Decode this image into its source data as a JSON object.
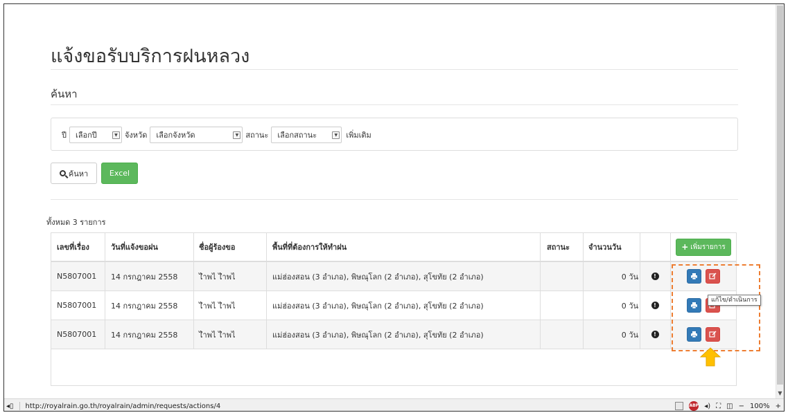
{
  "page": {
    "title": "แจ้งขอรับบริการฝนหลวง",
    "search_section_title": "ค้นหา"
  },
  "filters": {
    "year_label": "ปี",
    "year_value": "เลือกปี",
    "province_label": "จังหวัด",
    "province_value": "เลือกจังหวัด",
    "status_label": "สถานะ",
    "status_value": "เลือกสถานะ",
    "more_label": "เพิ่มเติม"
  },
  "actions": {
    "search_label": "ค้นหา",
    "excel_label": "Excel"
  },
  "table": {
    "total_text": "ทั้งหมด 3 รายการ",
    "headers": {
      "no": "เลขที่เรื่อง",
      "date": "วันที่แจ้งขอฝน",
      "name": "ชื่อผู้ร้องขอ",
      "area": "พื้นที่ที่ต้องการให้ทำฝน",
      "status": "สถานะ",
      "days": "จำนวนวัน"
    },
    "add_label": "เพิ่มรายการ",
    "rows": [
      {
        "no": "N5807001",
        "date": "14 กรกฎาคม 2558",
        "name": "ไำพไ ไำพไ",
        "area": "แม่ฮ่องสอน (3 อำเภอ), พิษณุโลก (2 อำเภอ), สุโขทัย (2 อำเภอ)",
        "status": "",
        "days": "0 วัน"
      },
      {
        "no": "N5807001",
        "date": "14 กรกฎาคม 2558",
        "name": "ไำพไ ไำพไ",
        "area": "แม่ฮ่องสอน (3 อำเภอ), พิษณุโลก (2 อำเภอ), สุโขทัย (2 อำเภอ)",
        "status": "",
        "days": "0 วัน"
      },
      {
        "no": "N5807001",
        "date": "14 กรกฎาคม 2558",
        "name": "ไำพไ ไำพไ",
        "area": "แม่ฮ่องสอน (3 อำเภอ), พิษณุโลก (2 อำเภอ), สุโขทัย (2 อำเภอ)",
        "status": "",
        "days": "0 วัน"
      }
    ]
  },
  "tooltip": {
    "edit_text": "แก้ไข/ดำเนินการ"
  },
  "statusbar": {
    "url": "http://royalrain.go.th/royalrain/admin/requests/actions/4",
    "zoom": "100%",
    "adblock_text": "ABP"
  },
  "colors": {
    "success": "#5cb85c",
    "primary": "#337ab7",
    "danger": "#d9534f",
    "highlight": "#ed7d31",
    "arrow": "#ffc000"
  }
}
